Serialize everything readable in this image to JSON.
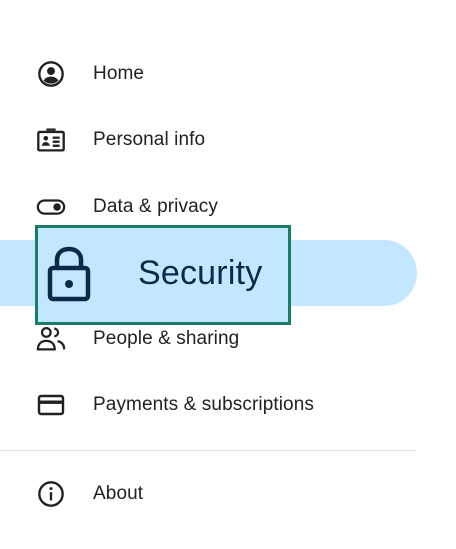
{
  "nav": {
    "items": [
      {
        "label": "Home",
        "icon": "account-circle-icon"
      },
      {
        "label": "Personal info",
        "icon": "id-card-icon"
      },
      {
        "label": "Data & privacy",
        "icon": "toggle-icon"
      },
      {
        "label": "Security",
        "icon": "lock-icon",
        "active": true
      },
      {
        "label": "People & sharing",
        "icon": "people-icon"
      },
      {
        "label": "Payments & subscriptions",
        "icon": "credit-card-icon"
      },
      {
        "label": "About",
        "icon": "info-icon"
      }
    ]
  },
  "colors": {
    "active_background": "#c2e7ff",
    "highlight_border": "#1a7f62",
    "text": "#202124",
    "active_text": "#0b2a4a"
  }
}
